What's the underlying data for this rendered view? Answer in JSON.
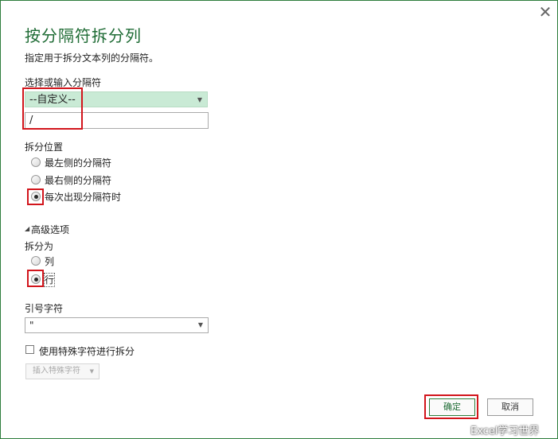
{
  "dialog": {
    "title": "按分隔符拆分列",
    "description": "指定用于拆分文本列的分隔符。",
    "close_glyph": "✕"
  },
  "delimiter": {
    "label": "选择或输入分隔符",
    "selected": "--自定义--",
    "custom_value": "/"
  },
  "split_at": {
    "label": "拆分位置",
    "options": [
      "最左侧的分隔符",
      "最右侧的分隔符",
      "每次出现分隔符时"
    ],
    "selected_index": 2
  },
  "advanced": {
    "label": "高级选项",
    "split_into_label": "拆分为",
    "split_into_options": [
      "列",
      "行"
    ],
    "selected_index": 1,
    "quote_char_label": "引号字符",
    "quote_char_value": "\"",
    "special_chars_label": "使用特殊字符进行拆分",
    "special_chars_checked": false,
    "insert_special_label": "插入特殊字符"
  },
  "buttons": {
    "ok": "确定",
    "cancel": "取消"
  },
  "watermark": "Excel学习世界",
  "colors": {
    "accent": "#1e6b34",
    "highlight_red": "#d2151c",
    "select_bg": "#c9ead5"
  }
}
